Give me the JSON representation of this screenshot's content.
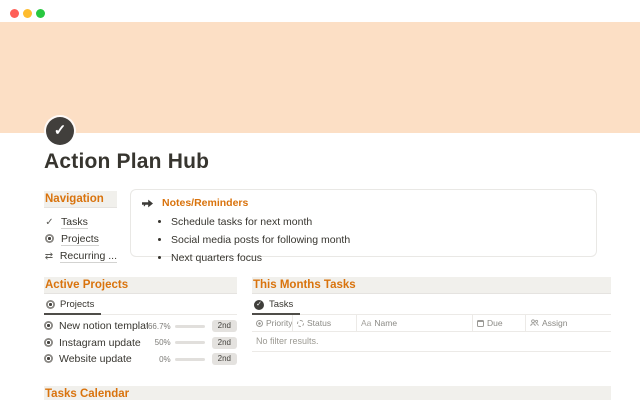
{
  "page": {
    "title": "Action Plan Hub"
  },
  "colors": {
    "accent_orange": "#d9730d",
    "cover_peach": "#fcdfc5",
    "heading_band": "#f1f0ec",
    "text_dark": "#37352f",
    "progress_fill": "#55534e",
    "traffic_red": "#ff5f57",
    "traffic_yellow": "#febc2e",
    "traffic_green": "#28c840"
  },
  "page_icon": {
    "glyph": "✓"
  },
  "navigation": {
    "heading": "Navigation",
    "items": [
      {
        "icon": "check-icon",
        "label": "Tasks"
      },
      {
        "icon": "disc-icon",
        "label": "Projects"
      },
      {
        "icon": "recurring-icon",
        "label": "Recurring ..."
      }
    ]
  },
  "callout": {
    "icon": "pointing-right-icon",
    "title": "Notes/Reminders",
    "bullets": [
      "Schedule tasks for next month",
      "Social media posts for following month",
      "Next quarters focus"
    ]
  },
  "active_projects": {
    "heading": "Active Projects",
    "tab": {
      "icon": "disc-icon",
      "label": "Projects"
    },
    "rows": [
      {
        "name": "New notion template",
        "percent": "66.7%",
        "value": 66.7,
        "badge": "2nd"
      },
      {
        "name": "Instagram update",
        "percent": "50%",
        "value": 50,
        "badge": "2nd"
      },
      {
        "name": "Website update",
        "percent": "0%",
        "value": 0,
        "badge": "2nd"
      }
    ]
  },
  "tasks": {
    "heading": "This Months Tasks",
    "tab": {
      "icon": "check-circle-icon",
      "label": "Tasks"
    },
    "columns": [
      {
        "icon": "priority-icon",
        "label": "Priority"
      },
      {
        "icon": "status-icon",
        "label": "Status"
      },
      {
        "icon": "text-type-icon",
        "prefix": "Aa",
        "label": "Name"
      },
      {
        "icon": "calendar-icon",
        "label": "Due"
      },
      {
        "icon": "people-icon",
        "label": "Assign"
      }
    ],
    "empty": "No filter results."
  },
  "calendar": {
    "heading": "Tasks Calendar"
  },
  "icons": {
    "nav_check": "✓",
    "nav_recurring": "⇄",
    "tab_check": "✓"
  }
}
